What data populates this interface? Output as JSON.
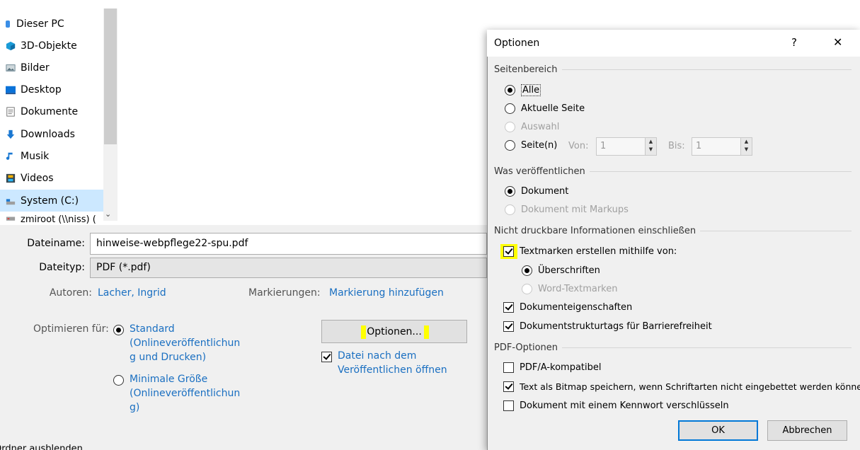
{
  "nav": {
    "items": [
      {
        "label": "Dieser PC",
        "icon": "pc-icon"
      },
      {
        "label": "3D-Objekte",
        "icon": "cube-icon"
      },
      {
        "label": "Bilder",
        "icon": "pictures-icon"
      },
      {
        "label": "Desktop",
        "icon": "desktop-icon"
      },
      {
        "label": "Dokumente",
        "icon": "documents-icon"
      },
      {
        "label": "Downloads",
        "icon": "download-arrow-icon"
      },
      {
        "label": "Musik",
        "icon": "music-note-icon"
      },
      {
        "label": "Videos",
        "icon": "film-icon"
      },
      {
        "label": "System (C:)",
        "icon": "drive-icon"
      },
      {
        "label": "zmiroot (\\\\niss) (",
        "icon": "network-drive-icon"
      }
    ]
  },
  "form": {
    "filename_label": "Dateiname:",
    "filename_value": "hinweise-webpflege22-spu.pdf",
    "filetype_label": "Dateityp:",
    "filetype_value": "PDF (*.pdf)",
    "authors_label": "Autoren:",
    "authors_value": "Lacher, Ingrid",
    "tags_label": "Markierungen:",
    "tags_value": "Markierung hinzufügen",
    "optimize_label": "Optimieren für:",
    "opt_standard": [
      "Standard",
      "(Onlineveröffentlichun",
      "g und Drucken)"
    ],
    "opt_minimal": [
      "Minimale Größe",
      "(Onlineveröffentlichun",
      "g)"
    ],
    "options_button": "Optionen...",
    "open_after": [
      "Datei nach dem",
      "Veröffentlichen öffnen"
    ],
    "hide_folders": "Ordner ausblenden"
  },
  "dialog": {
    "title": "Optionen",
    "help": "?",
    "close": "✕",
    "page_range": {
      "heading": "Seitenbereich",
      "all": "Alle",
      "current": "Aktuelle Seite",
      "selection": "Auswahl",
      "pages": "Seite(n)",
      "from_label": "Von:",
      "from_value": "1",
      "to_label": "Bis:",
      "to_value": "1"
    },
    "publish": {
      "heading": "Was veröffentlichen",
      "document": "Dokument",
      "with_markups": "Dokument mit Markups"
    },
    "nonprint": {
      "heading": "Nicht druckbare Informationen einschließen",
      "bookmarks": "Textmarken erstellen mithilfe von:",
      "headings": "Überschriften",
      "word_bookmarks": "Word-Textmarken",
      "properties": "Dokumenteigenschaften",
      "struct_tags": "Dokumentstrukturtags für Barrierefreiheit"
    },
    "pdf": {
      "heading": "PDF-Optionen",
      "pdfa": "PDF/A-kompatibel",
      "bitmap": "Text als Bitmap speichern, wenn Schriftarten nicht eingebettet werden können",
      "encrypt": "Dokument mit einem Kennwort verschlüsseln"
    },
    "ok": "OK",
    "cancel": "Abbrechen"
  },
  "colors": {
    "link": "#1a6fc1",
    "highlight": "#ffff00",
    "accent": "#0078d7"
  }
}
